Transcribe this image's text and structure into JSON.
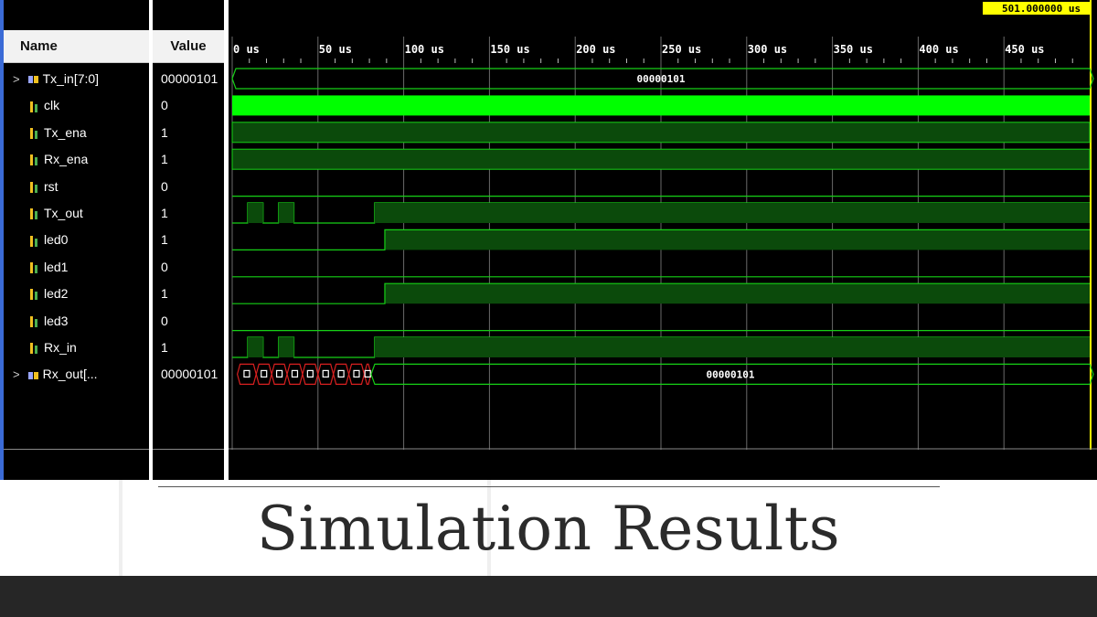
{
  "headers": {
    "name": "Name",
    "value": "Value"
  },
  "cursor_time": "501.000000 us",
  "time_labels": [
    "0 us",
    "50 us",
    "100 us",
    "150 us",
    "200 us",
    "250 us",
    "300 us",
    "350 us",
    "400 us",
    "450 us"
  ],
  "signals": [
    {
      "name": "Tx_in[7:0]",
      "value": "00000101",
      "type": "bus",
      "expandable": true,
      "bus_text": "00000101"
    },
    {
      "name": "clk",
      "value": "0",
      "type": "clock"
    },
    {
      "name": "Tx_ena",
      "value": "1",
      "type": "high"
    },
    {
      "name": "Rx_ena",
      "value": "1",
      "type": "high"
    },
    {
      "name": "rst",
      "value": "0",
      "type": "low"
    },
    {
      "name": "Tx_out",
      "value": "1",
      "type": "pulses"
    },
    {
      "name": "led0",
      "value": "1",
      "type": "step"
    },
    {
      "name": "led1",
      "value": "0",
      "type": "low"
    },
    {
      "name": "led2",
      "value": "1",
      "type": "step"
    },
    {
      "name": "led3",
      "value": "0",
      "type": "low"
    },
    {
      "name": "Rx_in",
      "value": "1",
      "type": "pulses"
    },
    {
      "name": "Rx_out[...",
      "value": "00000101",
      "type": "bus_transitions",
      "expandable": true,
      "bus_text": "00000101"
    }
  ],
  "slide_title": "Simulation Results",
  "colors": {
    "wave_green": "#16d016",
    "wave_fill": "#0b4a0b",
    "clock": "#00ff00",
    "bus_transition": "#d92020",
    "cursor_label_bg": "#ffff00"
  }
}
